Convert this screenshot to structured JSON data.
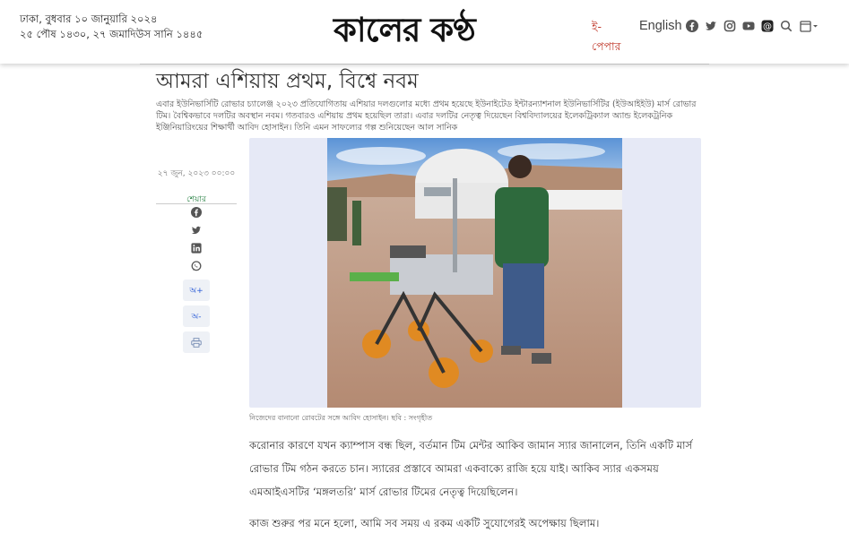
{
  "header": {
    "date_line1": "ঢাকা, বুধবার ১০ জানুয়ারি ২০২৪",
    "date_line2": "২৫ পৌষ ১৪৩০, ২৭ জমাদিউস সানি ১৪৪৫",
    "logo": "কালের কণ্ঠ",
    "epaper_label": "ই-পেপার",
    "english_label": "English",
    "icons": [
      "facebook-icon",
      "twitter-icon",
      "instagram-icon",
      "youtube-icon",
      "threads-icon",
      "search-icon",
      "calendar-icon"
    ]
  },
  "article": {
    "title": "আমরা এশিয়ায় প্রথম, বিশ্বে নবম",
    "lead": "এবার ইউনিভার্সিটি রোভার চ্যালেঞ্জ ২০২৩ প্রতিযোগিতায় এশিয়ার দলগুলোর মধ্যে প্রথম হয়েছে ইউনাইটেড ইন্টারন্যাশনাল ইউনিভার্সিটির (ইউআইইউ) মার্স রোভার টিম। বৈশ্বিকভাবে দলটির অবস্থান নবম। গতবারও এশিয়ায় প্রথম হয়েছিল তারা। এবার দলটির নেতৃত্ব দিয়েছেন বিশ্ববিদ্যালয়ের ইলেকট্রিক্যাল অ্যান্ড ইলেকট্রনিক ইঞ্জিনিয়ারিংয়ের শিক্ষার্থী আবিদ হোসাইন। তিনি এমন সাফল্যের গল্প শুনিয়েছেন আল সানিক",
    "published": "২৭ জুন, ২০২৩ ০০:০০",
    "share_label": "শেয়ার",
    "share_icons": [
      "facebook-icon",
      "twitter-icon",
      "linkedin-icon",
      "whatsapp-icon"
    ],
    "font_increase": "অ+",
    "font_decrease": "অ-",
    "print_icon": "print-icon",
    "caption": "নিজেদের বানানো রোবটের সঙ্গে আবিদ হোসাইন। ছবি : সংগৃহীত",
    "paragraphs": [
      "করোনার কারণে যখন ক্যাম্পাস বন্ধ ছিল, বর্তমান টিম মেন্টর আকিব জামান স্যার জানালেন, তিনি একটি মার্স রোভার টিম গঠন করতে চান। স্যারের প্রস্তাবে আমরা একবাক্যে রাজি হয়ে যাই। আকিব স্যার একসময় এমআইএসটির ‘মঙ্গলতরি’ মার্স রোভার টিমের নেতৃত্ব দিয়েছিলেন।",
      "কাজ শুরুর পর মনে হলো, আমি সব সময় এ রকম একটি সুযোগেরই অপেক্ষায় ছিলাম।"
    ]
  },
  "colors": {
    "epaper": "#c0392b",
    "share_green": "#1d7a3a",
    "button_blue": "#2a5bd7",
    "photo_frame": "#e6e9f6"
  }
}
